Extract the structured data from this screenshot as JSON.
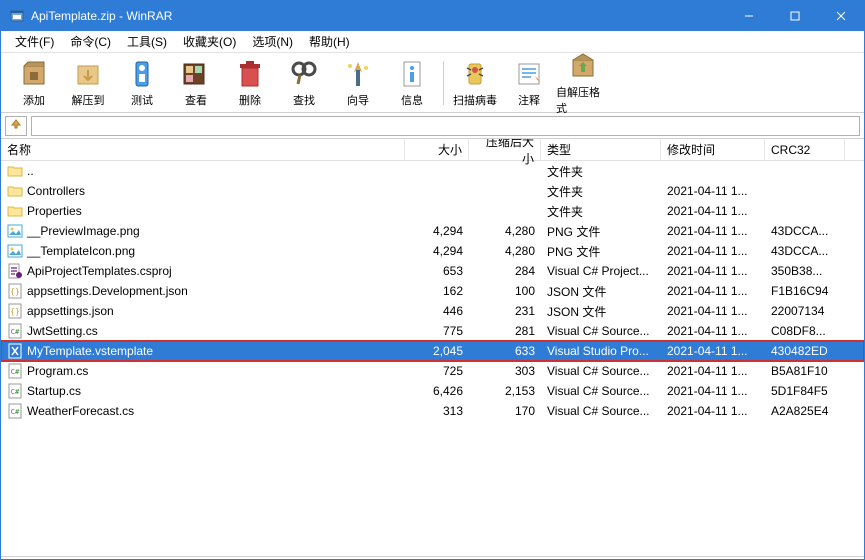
{
  "window": {
    "title": "ApiTemplate.zip - WinRAR"
  },
  "menu": {
    "file": "文件(F)",
    "commands": "命令(C)",
    "tools": "工具(S)",
    "favorites": "收藏夹(O)",
    "options": "选项(N)",
    "help": "帮助(H)"
  },
  "toolbar": {
    "add": "添加",
    "extract": "解压到",
    "test": "测试",
    "view": "查看",
    "delete": "删除",
    "find": "查找",
    "wizard": "向导",
    "info": "信息",
    "virusscan": "扫描病毒",
    "comment": "注释",
    "sfx": "自解压格式"
  },
  "columns": {
    "name": "名称",
    "size": "大小",
    "packed": "压缩后大小",
    "type": "类型",
    "modified": "修改时间",
    "crc": "CRC32"
  },
  "types": {
    "folder": "文件夹",
    "png": "PNG 文件",
    "csproj": "Visual C# Project...",
    "json": "JSON 文件",
    "cs": "Visual C# Source...",
    "vstemplate": "Visual Studio Pro..."
  },
  "rows": [
    {
      "icon": "folder-up",
      "name": "..",
      "size": "",
      "packed": "",
      "typeKey": "folder",
      "modified": "",
      "crc": "",
      "selected": false
    },
    {
      "icon": "folder",
      "name": "Controllers",
      "size": "",
      "packed": "",
      "typeKey": "folder",
      "modified": "2021-04-11 1...",
      "crc": "",
      "selected": false
    },
    {
      "icon": "folder",
      "name": "Properties",
      "size": "",
      "packed": "",
      "typeKey": "folder",
      "modified": "2021-04-11 1...",
      "crc": "",
      "selected": false
    },
    {
      "icon": "image",
      "name": "__PreviewImage.png",
      "size": "4,294",
      "packed": "4,280",
      "typeKey": "png",
      "modified": "2021-04-11 1...",
      "crc": "43DCCA...",
      "selected": false
    },
    {
      "icon": "image",
      "name": "__TemplateIcon.png",
      "size": "4,294",
      "packed": "4,280",
      "typeKey": "png",
      "modified": "2021-04-11 1...",
      "crc": "43DCCA...",
      "selected": false
    },
    {
      "icon": "csproj",
      "name": "ApiProjectTemplates.csproj",
      "size": "653",
      "packed": "284",
      "typeKey": "csproj",
      "modified": "2021-04-11 1...",
      "crc": "350B38...",
      "selected": false
    },
    {
      "icon": "json",
      "name": "appsettings.Development.json",
      "size": "162",
      "packed": "100",
      "typeKey": "json",
      "modified": "2021-04-11 1...",
      "crc": "F1B16C94",
      "selected": false
    },
    {
      "icon": "json",
      "name": "appsettings.json",
      "size": "446",
      "packed": "231",
      "typeKey": "json",
      "modified": "2021-04-11 1...",
      "crc": "22007134",
      "selected": false
    },
    {
      "icon": "cs",
      "name": "JwtSetting.cs",
      "size": "775",
      "packed": "281",
      "typeKey": "cs",
      "modified": "2021-04-11 1...",
      "crc": "C08DF8...",
      "selected": false
    },
    {
      "icon": "vstemplate",
      "name": "MyTemplate.vstemplate",
      "size": "2,045",
      "packed": "633",
      "typeKey": "vstemplate",
      "modified": "2021-04-11 1...",
      "crc": "430482ED",
      "selected": true
    },
    {
      "icon": "cs",
      "name": "Program.cs",
      "size": "725",
      "packed": "303",
      "typeKey": "cs",
      "modified": "2021-04-11 1...",
      "crc": "B5A81F10",
      "selected": false
    },
    {
      "icon": "cs",
      "name": "Startup.cs",
      "size": "6,426",
      "packed": "2,153",
      "typeKey": "cs",
      "modified": "2021-04-11 1...",
      "crc": "5D1F84F5",
      "selected": false
    },
    {
      "icon": "cs",
      "name": "WeatherForecast.cs",
      "size": "313",
      "packed": "170",
      "typeKey": "cs",
      "modified": "2021-04-11 1...",
      "crc": "A2A825E4",
      "selected": false
    }
  ]
}
